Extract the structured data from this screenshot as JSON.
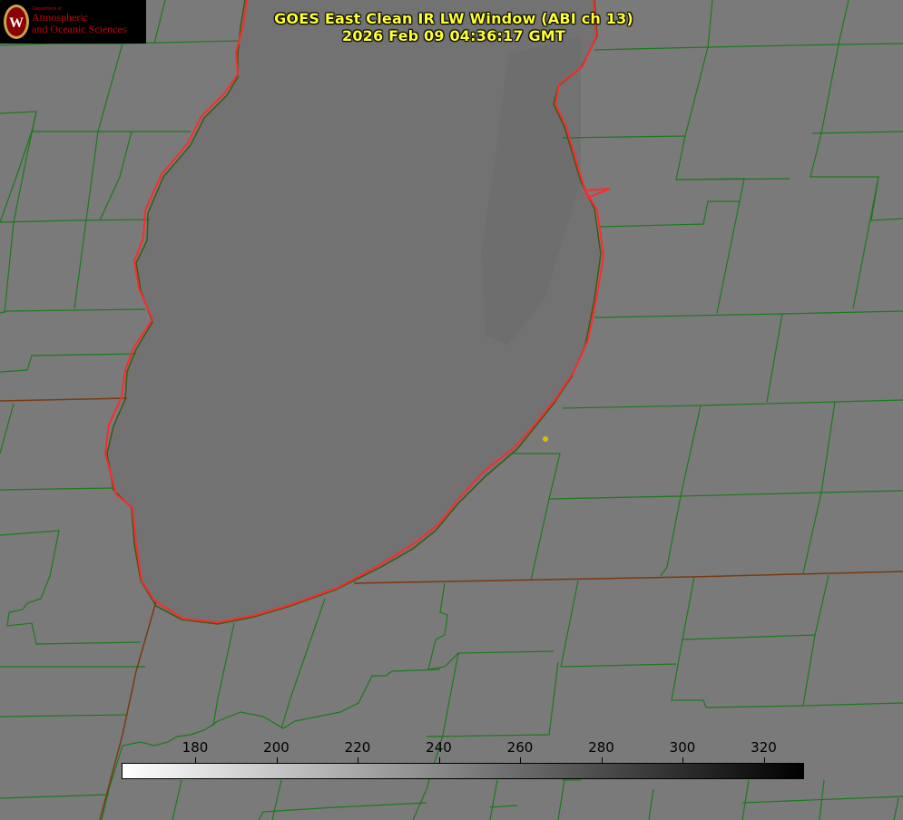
{
  "title": {
    "line1": "GOES East Clean IR LW Window (ABI ch 13)",
    "line2": "2026 Feb 09 04:36:17 GMT"
  },
  "logo": {
    "department": "Department of",
    "name_line1": "Atmospheric",
    "name_line2": "and Oceanic Sciences",
    "seal_letter": "W",
    "colors": {
      "background": "#000000",
      "text": "#c5050c",
      "seal": "#8b0000"
    }
  },
  "colorbar": {
    "ticks": [
      "180",
      "200",
      "220",
      "240",
      "260",
      "280",
      "300",
      "320"
    ],
    "gradient_from": "#ffffff",
    "gradient_to": "#000000"
  },
  "map": {
    "colors": {
      "land": "#7a7a7a",
      "lake": "#727272",
      "county_lines": "#1a7a1a",
      "state_lines": "#7a3a10",
      "coast_outline": "#ff2a2a",
      "marker": "#d6c200"
    }
  }
}
